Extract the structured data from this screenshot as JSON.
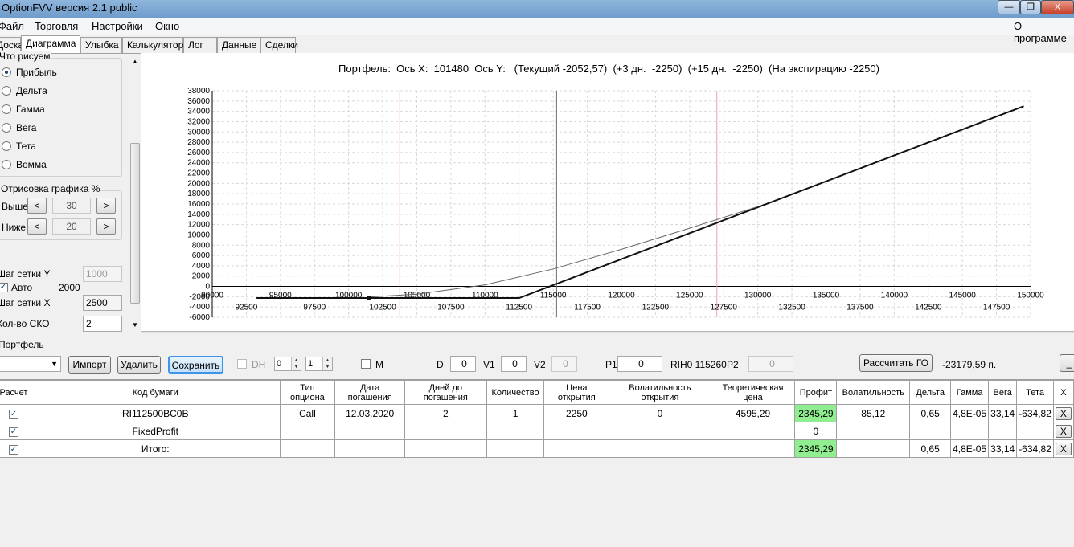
{
  "window": {
    "title": "OptionFVV версия 2.1 public",
    "minimize": "—",
    "maximize": "❐",
    "close": "X"
  },
  "menu": {
    "file": "Файл",
    "trade": "Торговля",
    "settings": "Настройки",
    "window": "Окно",
    "about": "О программе"
  },
  "tabs": [
    "Доска",
    "Диаграмма",
    "Улыбка",
    "Калькулятор",
    "Лог",
    "Данные",
    "Сделки"
  ],
  "left": {
    "draw_group": "Что рисуем",
    "radios": [
      "Прибыль",
      "Дельта",
      "Гамма",
      "Вега",
      "Тета",
      "Вомма"
    ],
    "selected_radio": "Прибыль",
    "render_group": "Отрисовка графика %",
    "above_label": "Выше",
    "above_value": "30",
    "below_label": "Ниже",
    "below_value": "20",
    "spin_left": "<",
    "spin_right": ">",
    "grid_y_label": "Шаг сетки Y",
    "grid_y_value": "1000",
    "auto_label": "Авто",
    "auto_value": "2000",
    "auto_checked": true,
    "grid_x_label": "Шаг сетки X",
    "grid_x_value": "2500",
    "sko_label": "Кол-во СКО",
    "sko_value": "2"
  },
  "chart_header": "Портфель:  Ось X:  101480  Ось Y:   (Текущий -2052,57)  (+3 дн.  -2250)  (+15 дн.  -2250)  (На экспирацию -2250)",
  "chart_data": {
    "type": "line",
    "title": "Портфель:  Ось X:  101480  Ось Y:   (Текущий -2052,57)  (+3 дн.  -2250)  (+15 дн.  -2250)  (На экспирацию -2250)",
    "xlim": [
      90000,
      150000
    ],
    "ylim": [
      -6000,
      38000
    ],
    "x_ticks_upper": [
      90000,
      95000,
      100000,
      105000,
      110000,
      115000,
      120000,
      125000,
      130000,
      135000,
      140000,
      145000,
      150000
    ],
    "x_ticks_lower": [
      92500,
      97500,
      102500,
      107500,
      112500,
      117500,
      122500,
      127500,
      132500,
      137500,
      142500,
      147500
    ],
    "y_ticks": [
      38000,
      36000,
      34000,
      32000,
      30000,
      28000,
      26000,
      24000,
      22000,
      20000,
      18000,
      16000,
      14000,
      12000,
      10000,
      8000,
      6000,
      4000,
      2000,
      0,
      -2000,
      -4000,
      -6000
    ],
    "grid": true,
    "vertical_markers": {
      "pink": [
        103750,
        127000
      ],
      "current": 115250
    },
    "series": [
      {
        "color": "#111111",
        "points": [
          [
            93250,
            -2250
          ],
          [
            112500,
            -2250
          ],
          [
            149500,
            35000
          ]
        ]
      },
      {
        "color": "#666666",
        "points": [
          [
            101480,
            -2052
          ],
          [
            105000,
            -1500
          ],
          [
            110000,
            300
          ],
          [
            115000,
            3400
          ],
          [
            120000,
            7200
          ],
          [
            125000,
            11300
          ],
          [
            130000,
            15500
          ]
        ]
      }
    ],
    "point": [
      101480,
      -2250
    ]
  },
  "portfolio": {
    "label": "Портфель",
    "import": "Импорт",
    "delete": "Удалить",
    "save": "Сохранить",
    "dh": "DH",
    "spin_a": "0",
    "spin_b": "1",
    "m": "M",
    "d_label": "D",
    "d_value": "0",
    "v1_label": "V1",
    "v1_value": "0",
    "v2_label": "V2",
    "v2_value": "0",
    "p1_label": "P1",
    "p1_value": "0",
    "rih": "RIH0 115260",
    "p2_label": "P2",
    "p2_value": "0",
    "calc_go": "Рассчитать ГО",
    "go_value": "-23179,59 п.",
    "underscore": "_"
  },
  "table": {
    "headers": [
      "Расчет",
      "Код бумаги",
      "Тип опциона",
      "Дата погашения",
      "Дней до погашения",
      "Количество",
      "Цена открытия",
      "Волатильность открытия",
      "Теоретическая цена",
      "Профит",
      "Волатильность",
      "Дельта",
      "Гамма",
      "Вега",
      "Тета",
      "X"
    ],
    "rows": [
      [
        "✓",
        "RI112500BC0B",
        "Call",
        "12.03.2020",
        "2",
        "1",
        "2250",
        "0",
        "4595,29",
        "2345,29",
        "85,12",
        "0,65",
        "4,8E-05",
        "33,14",
        "-634,82",
        "X"
      ],
      [
        "✓",
        "FixedProfit",
        "",
        "",
        "",
        "",
        "",
        "",
        "",
        "0",
        "",
        "",
        "",
        "",
        "",
        "X"
      ],
      [
        "✓",
        "Итого:",
        "",
        "",
        "",
        "",
        "",
        "",
        "",
        "2345,29",
        "",
        "0,65",
        "4,8E-05",
        "33,14",
        "-634,82",
        "X"
      ]
    ]
  }
}
